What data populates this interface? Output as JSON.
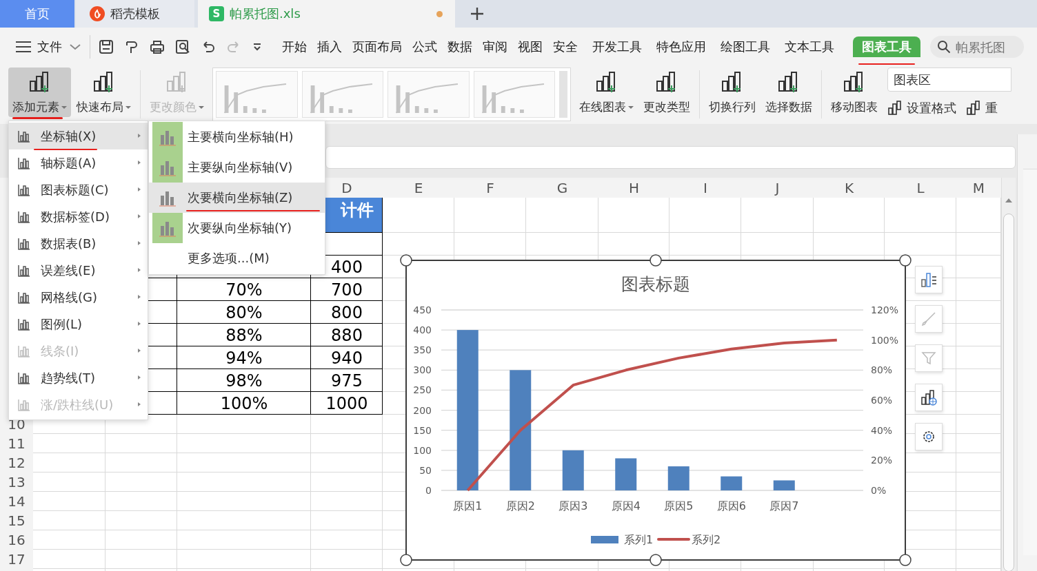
{
  "doc_tabs": [
    {
      "label": "首页",
      "kind": "home",
      "selected": false
    },
    {
      "label": "稻壳模板",
      "kind": "app",
      "selected": false
    },
    {
      "label": "帕累托图.xls",
      "kind": "document",
      "selected": true,
      "unsaved": true,
      "icon_letter": "S"
    }
  ],
  "menu_bar": {
    "file_menu": "文件",
    "tabs": [
      {
        "label": "开始",
        "selected": false,
        "underlined": false
      },
      {
        "label": "插入",
        "selected": false,
        "underlined": false
      },
      {
        "label": "页面布局",
        "selected": false,
        "underlined": false
      },
      {
        "label": "公式",
        "selected": false,
        "underlined": false
      },
      {
        "label": "数据",
        "selected": false,
        "underlined": false
      },
      {
        "label": "审阅",
        "selected": false,
        "underlined": false
      },
      {
        "label": "视图",
        "selected": false,
        "underlined": false
      },
      {
        "label": "安全",
        "selected": false,
        "underlined": false
      },
      {
        "label": "开发工具",
        "selected": false,
        "underlined": false
      },
      {
        "label": "特色应用",
        "selected": false,
        "underlined": false
      },
      {
        "label": "绘图工具",
        "selected": false,
        "underlined": false
      },
      {
        "label": "文本工具",
        "selected": false,
        "underlined": false
      },
      {
        "label": "图表工具",
        "selected": true,
        "underlined": true
      }
    ],
    "search": {
      "placeholder": "帕累托图"
    }
  },
  "ribbon": {
    "groups": [
      {
        "items": [
          {
            "kind": "button",
            "label": "添加元素",
            "dropdown": true,
            "pressed": true,
            "disabled": false,
            "underlined": true
          },
          {
            "kind": "button",
            "label": "快速布局",
            "dropdown": true,
            "pressed": false,
            "disabled": false,
            "underlined": false
          }
        ]
      },
      {
        "items": [
          {
            "kind": "button",
            "label": "更改颜色",
            "dropdown": true,
            "pressed": false,
            "disabled": true,
            "underlined": false
          },
          {
            "kind": "gallery"
          },
          {
            "kind": "button",
            "label": "在线图表",
            "dropdown": true,
            "pressed": false,
            "disabled": false,
            "underlined": false
          },
          {
            "kind": "button",
            "label": "更改类型",
            "dropdown": false,
            "pressed": false,
            "disabled": false,
            "underlined": false
          }
        ]
      },
      {
        "items": [
          {
            "kind": "button",
            "label": "切换行列",
            "dropdown": false,
            "pressed": false,
            "disabled": false,
            "underlined": false
          },
          {
            "kind": "button",
            "label": "选择数据",
            "dropdown": false,
            "pressed": false,
            "disabled": false,
            "underlined": false
          }
        ]
      },
      {
        "items": [
          {
            "kind": "button",
            "label": "移动图表",
            "dropdown": false,
            "pressed": false,
            "disabled": false,
            "underlined": false
          }
        ]
      }
    ],
    "chart_element_select": {
      "value": "图表区"
    },
    "format_buttons": [
      {
        "label": "设置格式"
      },
      {
        "label": "重"
      }
    ]
  },
  "sheet": {
    "column_headers": [
      "D",
      "E",
      "F",
      "G",
      "H",
      "I",
      "J",
      "K",
      "L",
      "M"
    ],
    "header_cell": "计件",
    "rows": [
      {
        "column_d": "400"
      },
      {
        "column_c": "70%",
        "column_d": "700"
      },
      {
        "column_c": "80%",
        "column_d": "800"
      },
      {
        "column_c": "88%",
        "column_d": "880"
      },
      {
        "column_c": "94%",
        "column_d": "940"
      },
      {
        "column_c": "98%",
        "column_d": "975"
      },
      {
        "column_c": "100%",
        "column_d": "1000"
      }
    ],
    "row_numbers": [
      "10",
      "11",
      "12",
      "13",
      "14",
      "15",
      "16",
      "17"
    ]
  },
  "add_element_menu": {
    "items": [
      {
        "label": "坐标轴(X)",
        "selected": true,
        "disabled": false,
        "underlined": true
      },
      {
        "label": "轴标题(A)",
        "selected": false,
        "disabled": false,
        "underlined": false
      },
      {
        "label": "图表标题(C)",
        "selected": false,
        "disabled": false,
        "underlined": false
      },
      {
        "label": "数据标签(D)",
        "selected": false,
        "disabled": false,
        "underlined": false
      },
      {
        "label": "数据表(B)",
        "selected": false,
        "disabled": false,
        "underlined": false
      },
      {
        "label": "误差线(E)",
        "selected": false,
        "disabled": false,
        "underlined": false
      },
      {
        "label": "网格线(G)",
        "selected": false,
        "disabled": false,
        "underlined": false
      },
      {
        "label": "图例(L)",
        "selected": false,
        "disabled": false,
        "underlined": false
      },
      {
        "label": "线条(I)",
        "selected": false,
        "disabled": true,
        "underlined": false
      },
      {
        "label": "趋势线(T)",
        "selected": false,
        "disabled": false,
        "underlined": false
      },
      {
        "label": "涨/跌柱线(U)",
        "selected": false,
        "disabled": true,
        "underlined": false
      }
    ]
  },
  "axis_submenu": {
    "items": [
      {
        "kind": "axis",
        "label": "主要横向坐标轴(H)",
        "checked": true,
        "selected": false,
        "underlined": false
      },
      {
        "kind": "axis",
        "label": "主要纵向坐标轴(V)",
        "checked": true,
        "selected": false,
        "underlined": false
      },
      {
        "kind": "axis",
        "label": "次要横向坐标轴(Z)",
        "checked": false,
        "selected": true,
        "underlined": true
      },
      {
        "kind": "axis",
        "label": "次要纵向坐标轴(Y)",
        "checked": true,
        "selected": false,
        "underlined": false
      },
      {
        "kind": "command",
        "label": "更多选项...(M)",
        "selected": false,
        "underlined": false
      }
    ]
  },
  "chart": {
    "selected": true,
    "chart_data": {
      "type": "bar",
      "title": "图表标题",
      "categories": [
        "原因1",
        "原因2",
        "原因3",
        "原因4",
        "原因5",
        "原因6",
        "原因7",
        null
      ],
      "series": [
        {
          "name": "系列1",
          "color": "#4f81bd",
          "values": [
            400,
            300,
            100,
            80,
            60,
            35,
            25,
            null
          ]
        },
        {
          "name": "系列2",
          "color": "#c0504d",
          "type": "line",
          "axis": "y2",
          "values": [
            0,
            0.4,
            0.7,
            0.8,
            0.88,
            0.94,
            0.98,
            1.0
          ]
        }
      ],
      "grid": true,
      "legend": true,
      "ylim": [
        0,
        450
      ],
      "yticks": [
        0,
        50,
        100,
        150,
        200,
        250,
        300,
        350,
        400,
        450
      ],
      "y2lim": [
        0,
        1.2
      ],
      "y2ticks": [
        {
          "value": 0,
          "label": "0%"
        },
        {
          "value": 0.2,
          "label": "20%"
        },
        {
          "value": 0.4,
          "label": "40%"
        },
        {
          "value": 0.6,
          "label": "60%"
        },
        {
          "value": 0.8,
          "label": "80%"
        },
        {
          "value": 1.0,
          "label": "100%"
        },
        {
          "value": 1.2,
          "label": "120%"
        }
      ]
    }
  }
}
